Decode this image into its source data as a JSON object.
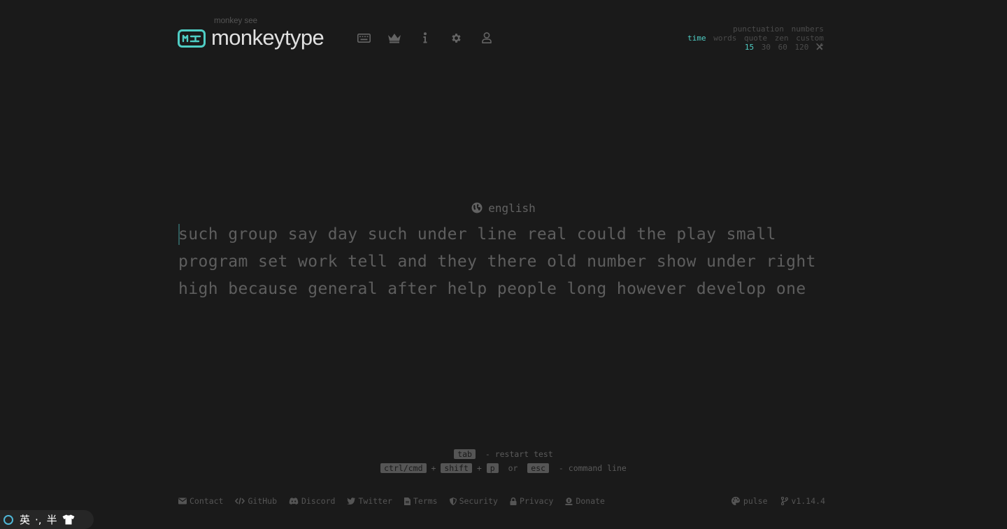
{
  "header": {
    "logo_sub": "monkey see",
    "logo_title": "monkeytype",
    "nav": [
      {
        "icon": "keyboard-icon"
      },
      {
        "icon": "crown-icon"
      },
      {
        "icon": "info-icon"
      },
      {
        "icon": "gear-icon"
      },
      {
        "icon": "user-icon"
      }
    ]
  },
  "config": {
    "punctuation": "punctuation",
    "numbers": "numbers",
    "modes": [
      "time",
      "words",
      "quote",
      "zen",
      "custom"
    ],
    "active_mode": "time",
    "times": [
      "15",
      "30",
      "60",
      "120"
    ],
    "active_time": "15"
  },
  "test": {
    "language": "english",
    "lines": [
      "such group say day such under line real could the play small",
      "program set work tell and they there old number show under right",
      "high because general after help people long however develop one"
    ]
  },
  "keytips": {
    "tab": "tab",
    "restart": "- restart test",
    "ctrl": "ctrl/cmd",
    "plus": "+",
    "shift": "shift",
    "p": "p",
    "or": "or",
    "esc": "esc",
    "command": "- command line"
  },
  "footer": {
    "links": [
      "Contact",
      "GitHub",
      "Discord",
      "Twitter",
      "Terms",
      "Security",
      "Privacy",
      "Donate"
    ],
    "theme": "pulse",
    "version": "v1.14.4"
  },
  "ime": {
    "lang": "英",
    "punct": "·,",
    "width": "半"
  },
  "colors": {
    "background": "#1a1a1a",
    "accent": "#4fcdc4",
    "text": "#e0e0e0",
    "sub": "#555555"
  }
}
